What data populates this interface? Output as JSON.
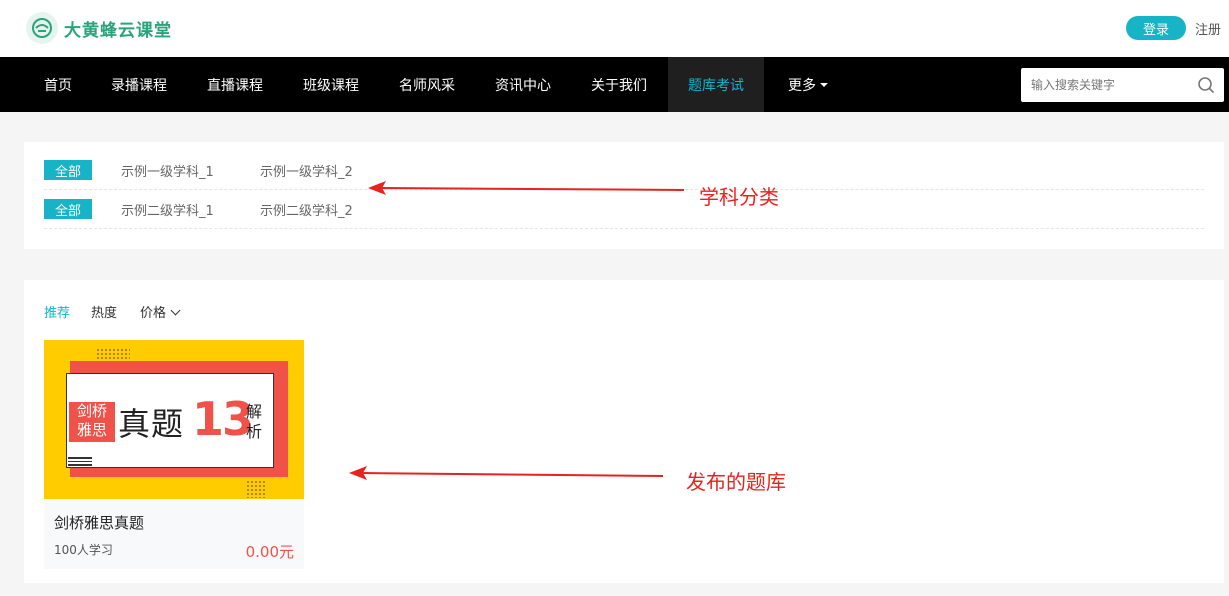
{
  "header": {
    "brand": "大黄蜂云课堂",
    "login_label": "登录",
    "register_label": "注册"
  },
  "nav": {
    "items": [
      "首页",
      "录播课程",
      "直播课程",
      "班级课程",
      "名师风采",
      "资讯中心",
      "关于我们",
      "题库考试",
      "更多"
    ],
    "active": "题库考试",
    "search_placeholder": "输入搜索关键字"
  },
  "categories": {
    "rows": [
      {
        "all_label": "全部",
        "items": [
          "示例一级学科_1",
          "示例一级学科_2"
        ]
      },
      {
        "all_label": "全部",
        "items": [
          "示例二级学科_1",
          "示例二级学科_2"
        ]
      }
    ]
  },
  "sort": {
    "options": [
      "推荐",
      "热度",
      "价格"
    ],
    "active": "推荐"
  },
  "card": {
    "cover": {
      "badge_line1": "剑桥",
      "badge_line2": "雅思",
      "big_text": "真题",
      "number": "13",
      "side_line1": "解",
      "side_line2": "析"
    },
    "title": "剑桥雅思真题",
    "students": "100人学习",
    "price": "0.00元"
  },
  "annotations": {
    "category_label": "学科分类",
    "bank_label": "发布的题库"
  },
  "colors": {
    "accent": "#17b3c7",
    "brand_green": "#2aa37a",
    "price": "#f0524a",
    "annotation": "#e8231f",
    "cover_yellow": "#ffcc00"
  }
}
